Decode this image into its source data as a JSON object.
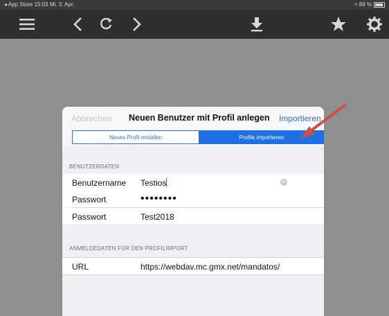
{
  "status": {
    "left": "◂ App Store  15:03  Mi. 3. Apr.",
    "right": "≈ 89 %"
  },
  "toolbar": {
    "icons": [
      "menu-icon",
      "back-icon",
      "refresh-icon",
      "forward-icon",
      "download-icon",
      "star-icon",
      "gear-icon"
    ]
  },
  "modal": {
    "cancel_label": "Abbrechen",
    "title": "Neuen Benutzer mit Profil anlegen",
    "import_label": "Importieren",
    "segments": [
      {
        "label": "Neues Profil erstellen",
        "selected": false
      },
      {
        "label": "Profile importieren",
        "selected": true
      }
    ],
    "section_user": "BENUTZERDATEN",
    "username_label": "Benutzername",
    "username_value": "Testios",
    "password_label": "Passwort",
    "password_masked": "••••••••",
    "password2_label": "Passwort",
    "password2_value": "Test2018",
    "section_import": "ANMELDEDATEN FÜR DEN PROFILIMPORT",
    "url_label": "URL",
    "url_value": "https://webdav.mc.gmx.net/mandatos/"
  },
  "colors": {
    "accent": "#1f6fe6",
    "annotation_arrow": "#c9514a"
  }
}
